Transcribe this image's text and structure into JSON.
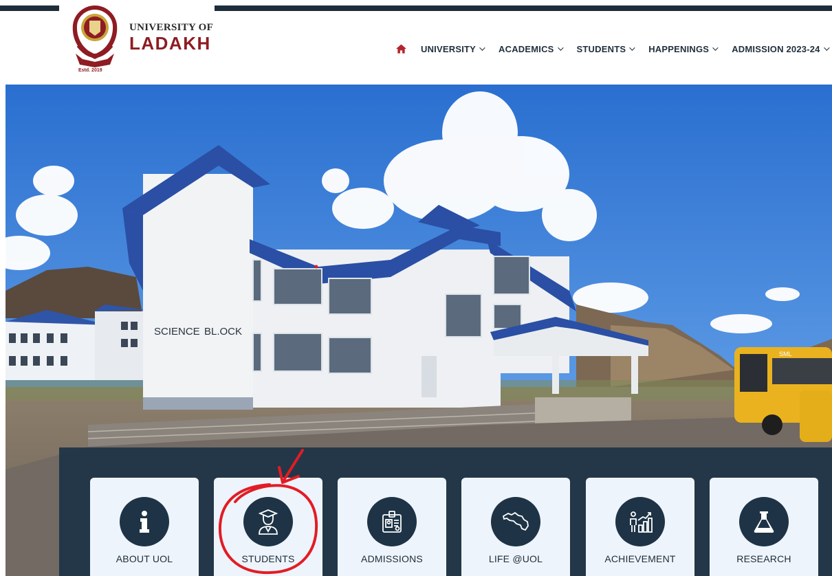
{
  "logo": {
    "line1": "UNIVERSITY OF",
    "line2": "LADAKH",
    "estd": "Estd. 2019"
  },
  "nav": {
    "home_icon": "home-icon",
    "items": [
      {
        "label": "UNIVERSITY"
      },
      {
        "label": "ACADEMICS"
      },
      {
        "label": "STUDENTS"
      },
      {
        "label": "HAPPENINGS"
      },
      {
        "label": "ADMISSION 2023-24"
      }
    ]
  },
  "hero": {
    "sign_left": "SCIENCE",
    "sign_right": "BL.OCK",
    "bus_text": "SML"
  },
  "cards": [
    {
      "label": "ABOUT UOL",
      "icon": "info-icon"
    },
    {
      "label": "STUDENTS",
      "icon": "graduate-icon"
    },
    {
      "label": "ADMISSIONS",
      "icon": "id-card-icon"
    },
    {
      "label": "LIFE @UOL",
      "icon": "ladakh-map-icon"
    },
    {
      "label": "ACHIEVEMENT",
      "icon": "growth-chart-icon"
    },
    {
      "label": "RESEARCH",
      "icon": "flask-icon"
    }
  ],
  "colors": {
    "brand_maroon": "#8e1c22",
    "nav_dark": "#1e2d3a",
    "panel": "#1e3446",
    "card_bg": "#eef4fb",
    "annotation": "#e21c24"
  }
}
